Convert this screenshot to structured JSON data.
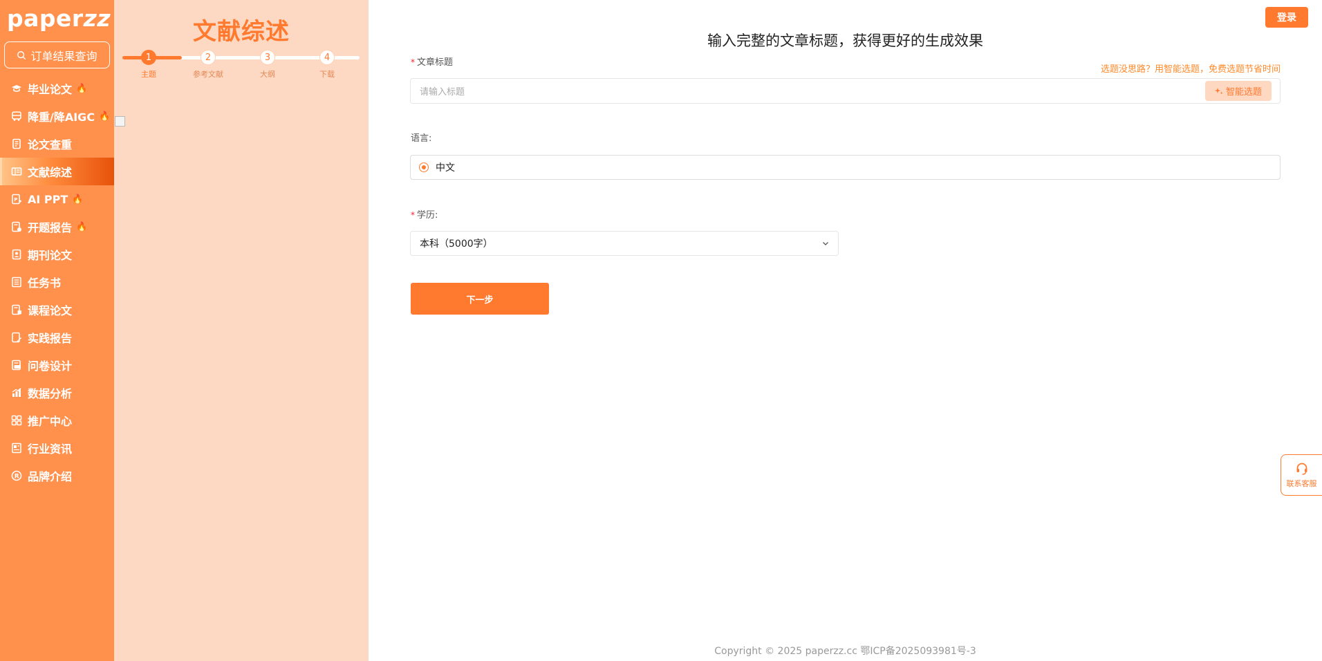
{
  "logo": {
    "text_main": "paper",
    "text_accent": "zz"
  },
  "sidebar": {
    "order_button": "订单结果查询",
    "items": [
      {
        "label": "毕业论文",
        "icon": "graduation-cap-icon",
        "hot": true
      },
      {
        "label": "降重/降AIGC",
        "icon": "bus-icon",
        "hot": true
      },
      {
        "label": "论文查重",
        "icon": "document-check-icon",
        "hot": false
      },
      {
        "label": "文献综述",
        "icon": "book-open-icon",
        "hot": false,
        "active": true
      },
      {
        "label": "AI PPT",
        "icon": "ppt-icon",
        "hot": true
      },
      {
        "label": "开题报告",
        "icon": "report-icon",
        "hot": true
      },
      {
        "label": "期刊论文",
        "icon": "journal-icon",
        "hot": false
      },
      {
        "label": "任务书",
        "icon": "task-book-icon",
        "hot": false
      },
      {
        "label": "课程论文",
        "icon": "course-paper-icon",
        "hot": false
      },
      {
        "label": "实践报告",
        "icon": "practice-report-icon",
        "hot": false
      },
      {
        "label": "问卷设计",
        "icon": "survey-icon",
        "hot": false
      },
      {
        "label": "数据分析",
        "icon": "chart-icon",
        "hot": false
      },
      {
        "label": "推广中心",
        "icon": "grid-icon",
        "hot": false
      },
      {
        "label": "行业资讯",
        "icon": "news-icon",
        "hot": false
      },
      {
        "label": "品牌介绍",
        "icon": "registered-icon",
        "hot": false
      }
    ],
    "fire_glyph": "🔥"
  },
  "steps": {
    "title": "文献综述",
    "items": [
      {
        "num": "1",
        "label": "主题",
        "active": true
      },
      {
        "num": "2",
        "label": "参考文献",
        "active": false
      },
      {
        "num": "3",
        "label": "大纲",
        "active": false
      },
      {
        "num": "4",
        "label": "下载",
        "active": false
      }
    ]
  },
  "header": {
    "login": "登录"
  },
  "form": {
    "heading": "输入完整的文章标题，获得更好的生成效果",
    "required_mark": "*",
    "title_label": "文章标题",
    "title_hint": "选题没思路？用智能选题，免费选题节省时间",
    "title_placeholder": "请输入标题",
    "ai_button": "智能选题",
    "language_label": "语言:",
    "language_value": "中文",
    "education_label": "学历:",
    "education_value": "本科（5000字）",
    "next_button": "下一步"
  },
  "support": {
    "label": "联系客服"
  },
  "footer": {
    "copyright": "Copyright © 2025 paperzz.cc 鄂ICP备2025093981号-3"
  },
  "colors": {
    "brand": "#ff7a2f",
    "sidebar": "#ff914d",
    "panel": "#fdd8c2"
  }
}
